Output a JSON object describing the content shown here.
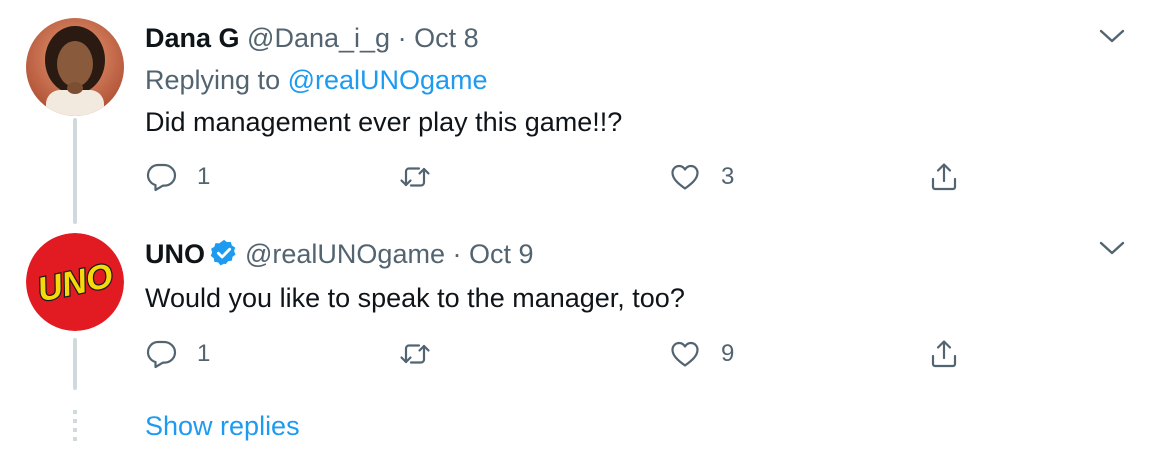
{
  "tweets": [
    {
      "display_name": "Dana G",
      "handle": "@Dana_i_g",
      "separator": "·",
      "date": "Oct 8",
      "replying_to_prefix": "Replying to ",
      "replying_to_handle": "@realUNOgame",
      "text": "Did management ever play this game!!?",
      "reply_count": "1",
      "like_count": "3"
    },
    {
      "display_name": "UNO",
      "handle": "@realUNOgame",
      "separator": "·",
      "date": "Oct 9",
      "verified": true,
      "avatar_logo_text": "UNO",
      "text": "Would you like to speak to the manager, too?",
      "reply_count": "1",
      "like_count": "9"
    }
  ],
  "show_replies_label": "Show replies",
  "colors": {
    "accent": "#1d9bf0",
    "secondary_text": "#536471",
    "thread_line": "#cfd9de",
    "uno_red": "#e21b23",
    "uno_yellow": "#f5d90a"
  }
}
